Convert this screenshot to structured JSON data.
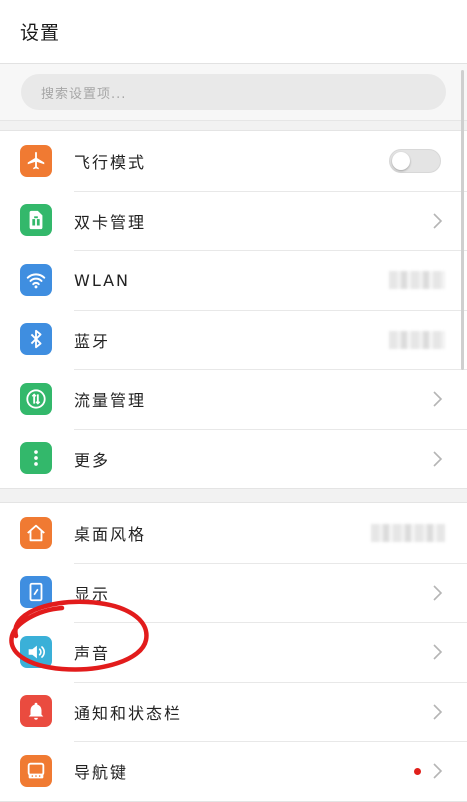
{
  "header": {
    "title": "设置"
  },
  "search": {
    "placeholder": "搜索设置项..."
  },
  "groups": [
    {
      "items": [
        {
          "label": "飞行模式",
          "icon": "airplane-icon",
          "color": "#f07a32",
          "control": "toggle",
          "toggle_on": false
        },
        {
          "label": "双卡管理",
          "icon": "sim-card-icon",
          "color": "#33b86b",
          "control": "chevron"
        },
        {
          "label": "WLAN",
          "icon": "wifi-icon",
          "color": "#3f8ee0",
          "control": "blurred-value"
        },
        {
          "label": "蓝牙",
          "icon": "bluetooth-icon",
          "color": "#3f8ee0",
          "control": "blurred-value"
        },
        {
          "label": "流量管理",
          "icon": "data-usage-icon",
          "color": "#33b86b",
          "control": "chevron"
        },
        {
          "label": "更多",
          "icon": "more-dots-icon",
          "color": "#33b86b",
          "control": "chevron"
        }
      ]
    },
    {
      "items": [
        {
          "label": "桌面风格",
          "icon": "home-icon",
          "color": "#f07a32",
          "control": "blurred-value"
        },
        {
          "label": "显示",
          "icon": "display-icon",
          "color": "#3f8ee0",
          "control": "chevron"
        },
        {
          "label": "声音",
          "icon": "speaker-icon",
          "color": "#3ab0d8",
          "control": "chevron"
        },
        {
          "label": "通知和状态栏",
          "icon": "bell-icon",
          "color": "#ea4b3f",
          "control": "chevron"
        },
        {
          "label": "导航键",
          "icon": "navigation-keys-icon",
          "color": "#f07a32",
          "control": "chevron",
          "badge": "red-dot"
        }
      ]
    }
  ],
  "annotation": {
    "color": "#e21c1c",
    "shape": "hand-drawn-circle",
    "target": "声音"
  }
}
